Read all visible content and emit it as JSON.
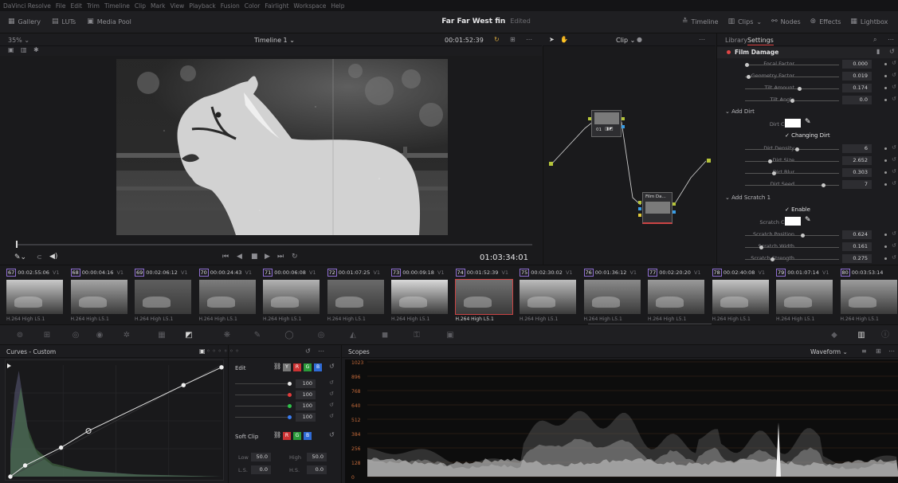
{
  "menu": [
    "DaVinci Resolve",
    "File",
    "Edit",
    "Trim",
    "Timeline",
    "Clip",
    "Mark",
    "View",
    "Playback",
    "Fusion",
    "Color",
    "Fairlight",
    "Workspace",
    "Help"
  ],
  "toolbar": {
    "left": [
      {
        "label": "Gallery"
      },
      {
        "label": "LUTs"
      },
      {
        "label": "Media Pool"
      }
    ],
    "project_title": "Far Far West fin",
    "project_status": "Edited",
    "right": [
      {
        "label": "Timeline"
      },
      {
        "label": "Clips"
      },
      {
        "label": "Nodes"
      },
      {
        "label": "Effects"
      },
      {
        "label": "Lightbox"
      }
    ]
  },
  "viewer": {
    "zoom": "35%",
    "timeline_name": "Timeline 1",
    "timecode": "00:01:52:39",
    "playhead_timecode": "01:03:34:01"
  },
  "node_editor": {
    "mode_label": "Clip",
    "node1_label": "01",
    "node2_label": "Film Da..."
  },
  "inspector": {
    "tabs": [
      "Library",
      "Settings"
    ],
    "effect_title": "Film Damage",
    "params_top": [
      {
        "label": "Focal Factor",
        "value": "0.000",
        "knob": 0.0
      },
      {
        "label": "Geometry Factor",
        "value": "0.019",
        "knob": 0.02
      },
      {
        "label": "Tilt Amount",
        "value": "0.174",
        "knob": 0.58
      },
      {
        "label": "Tilt Angle",
        "value": "0.0",
        "knob": 0.5
      }
    ],
    "section_dirt": "Add Dirt",
    "dirt_color_label": "Dirt Color",
    "changing_dirt_label": "Changing Dirt",
    "params_dirt": [
      {
        "label": "Dirt Density",
        "value": "6",
        "knob": 0.56
      },
      {
        "label": "Dirt Size",
        "value": "2.652",
        "knob": 0.26
      },
      {
        "label": "Dirt Blur",
        "value": "0.303",
        "knob": 0.3
      },
      {
        "label": "Dirt Seed",
        "value": "7",
        "knob": 0.85
      }
    ],
    "section_scratch": "Add Scratch 1",
    "enable_label": "Enable",
    "scratch_color_label": "Scratch Color",
    "params_scratch": [
      {
        "label": "Scratch Position",
        "value": "0.624",
        "knob": 0.62
      },
      {
        "label": "Scratch Width",
        "value": "0.161",
        "knob": 0.16
      },
      {
        "label": "Scratch Strength",
        "value": "0.275",
        "knob": 0.28
      }
    ]
  },
  "clips": [
    {
      "num": "67",
      "tc": "00:02:55:06",
      "track": "V1",
      "codec": "H.264 High L5.1",
      "tone": "#c9c9c9"
    },
    {
      "num": "68",
      "tc": "00:00:04:16",
      "track": "V1",
      "codec": "H.264 High L5.1",
      "tone": "#a5a5a5"
    },
    {
      "num": "69",
      "tc": "00:02:06:12",
      "track": "V1",
      "codec": "H.264 High L5.1",
      "tone": "#5e5e5e"
    },
    {
      "num": "70",
      "tc": "00:00:24:43",
      "track": "V1",
      "codec": "H.264 High L5.1",
      "tone": "#7d7d7d"
    },
    {
      "num": "71",
      "tc": "00:00:06:08",
      "track": "V1",
      "codec": "H.264 High L5.1",
      "tone": "#b3b3b3"
    },
    {
      "num": "72",
      "tc": "00:01:07:25",
      "track": "V1",
      "codec": "H.264 High L5.1",
      "tone": "#6a6a6a"
    },
    {
      "num": "73",
      "tc": "00:00:09:18",
      "track": "V1",
      "codec": "H.264 High L5.1",
      "tone": "#d9d9d9"
    },
    {
      "num": "74",
      "tc": "00:01:52:39",
      "track": "V1",
      "codec": "H.264 High L5.1",
      "tone": "#707070",
      "selected": true
    },
    {
      "num": "75",
      "tc": "00:02:30:02",
      "track": "V1",
      "codec": "H.264 High L5.1",
      "tone": "#bdbdbd"
    },
    {
      "num": "76",
      "tc": "00:01:36:12",
      "track": "V1",
      "codec": "H.264 High L5.1",
      "tone": "#8a8a8a"
    },
    {
      "num": "77",
      "tc": "00:02:20:20",
      "track": "V1",
      "codec": "H.264 High L5.1",
      "tone": "#9a9a9a"
    },
    {
      "num": "78",
      "tc": "00:02:40:08",
      "track": "V1",
      "codec": "H.264 High L5.1",
      "tone": "#c4c4c4"
    },
    {
      "num": "79",
      "tc": "00:01:07:14",
      "track": "V1",
      "codec": "H.264 High L5.1",
      "tone": "#a8a8a8"
    },
    {
      "num": "80",
      "tc": "00:03:53:14",
      "track": "V1",
      "codec": "H.264 High L5.1",
      "tone": "#9c9c9c"
    }
  ],
  "curves": {
    "title": "Curves - Custom",
    "edit_label": "Edit",
    "channel_values": [
      {
        "value": "100",
        "color": "#e8e8e8"
      },
      {
        "value": "100",
        "color": "#e23b3b"
      },
      {
        "value": "100",
        "color": "#2fc24a"
      },
      {
        "value": "100",
        "color": "#3a7cf0"
      }
    ],
    "soft_clip_label": "Soft Clip",
    "low_label": "Low",
    "low_value": "50.0",
    "high_label": "High",
    "high_value": "50.0",
    "ls_label": "L.S.",
    "ls_value": "0.0",
    "hs_label": "H.S.",
    "hs_value": "0.0",
    "points": [
      [
        0.0,
        0.0
      ],
      [
        0.07,
        0.1
      ],
      [
        0.24,
        0.26
      ],
      [
        0.37,
        0.41
      ],
      [
        0.82,
        0.82
      ],
      [
        1.0,
        0.98
      ]
    ]
  },
  "scopes": {
    "title": "Scopes",
    "mode": "Waveform",
    "ticks": [
      "1023",
      "896",
      "768",
      "640",
      "512",
      "384",
      "256",
      "128",
      "0"
    ]
  },
  "colors": {
    "accent": "#e04545",
    "panel": "#1c1c1f",
    "highlight_badge": "#8f6fd3",
    "selected_clip": "#c44444"
  }
}
